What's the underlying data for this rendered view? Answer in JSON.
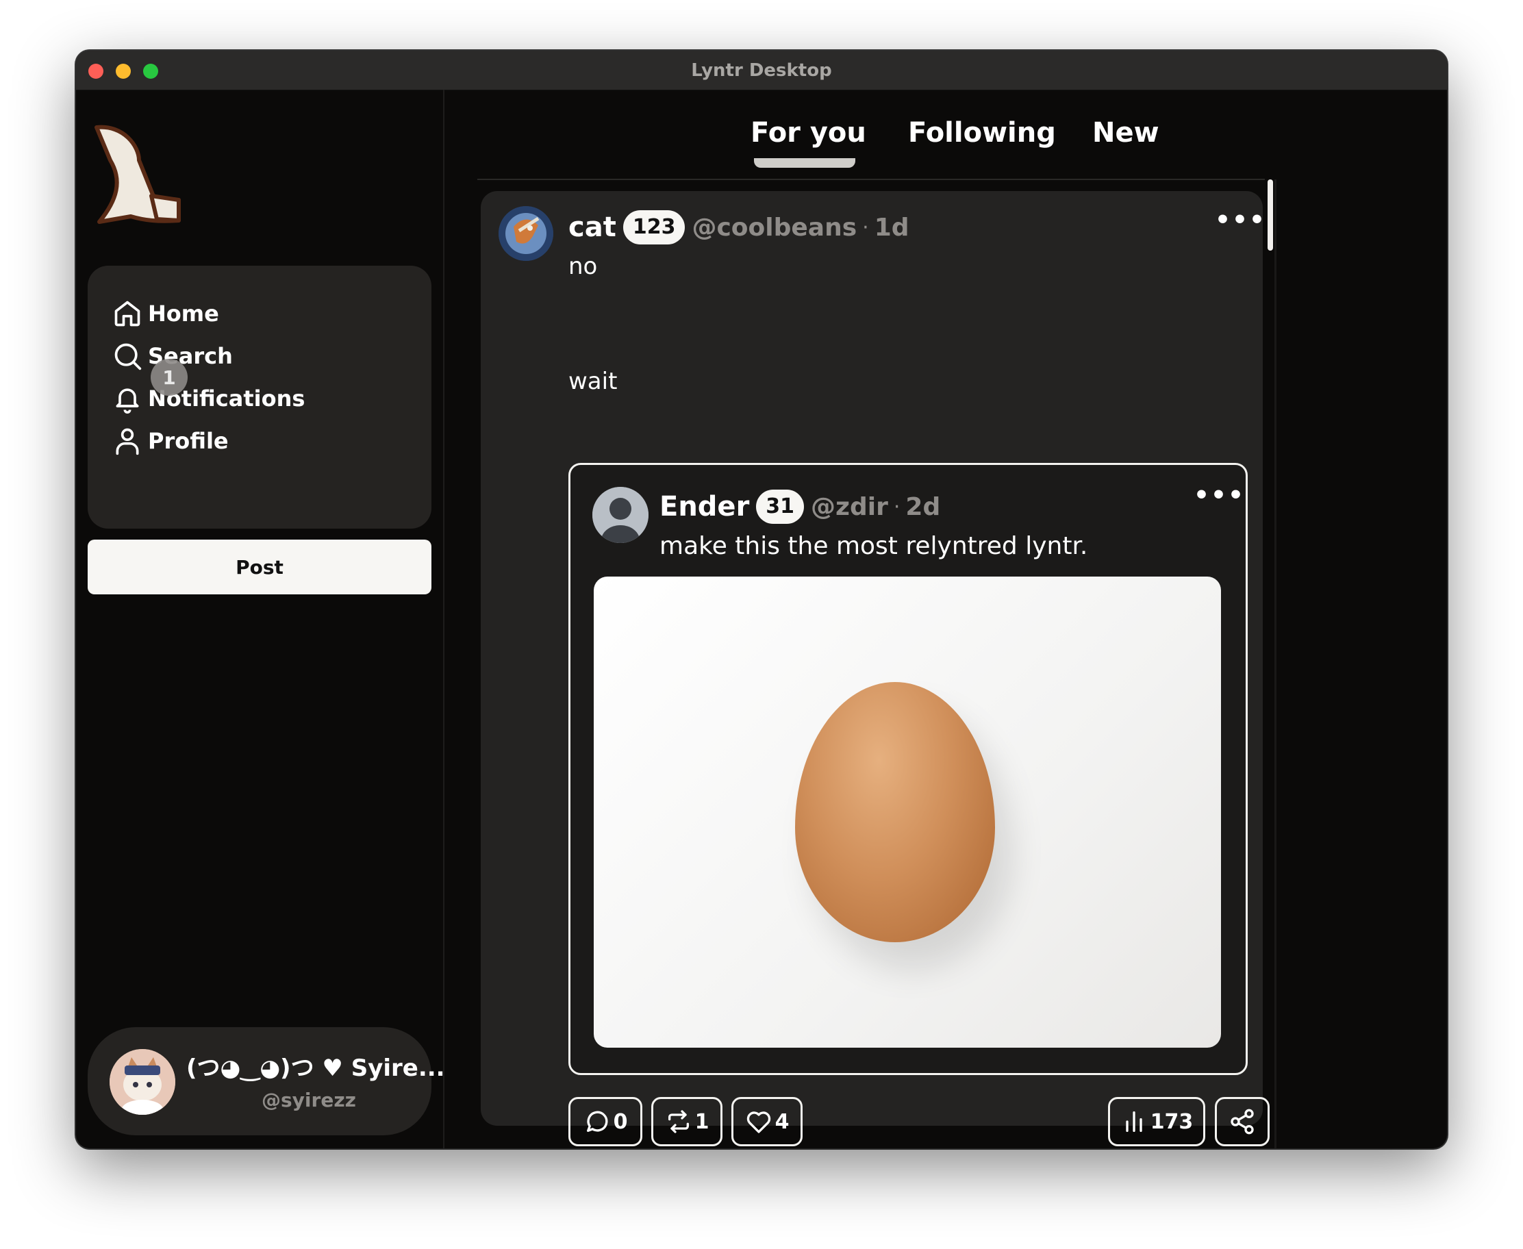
{
  "window": {
    "title": "Lyntr Desktop"
  },
  "sidebar": {
    "nav": [
      {
        "label": "Home",
        "icon": "home-icon"
      },
      {
        "label": "Search",
        "icon": "search-icon"
      },
      {
        "label": "Notifications",
        "icon": "bell-icon",
        "badge": "1"
      },
      {
        "label": "Profile",
        "icon": "user-icon"
      }
    ],
    "post_button": "Post",
    "account": {
      "name": "(つ◕‿◕)つ ♥ Syire...",
      "handle": "@syirezz"
    }
  },
  "tabs": [
    {
      "label": "For you",
      "active": true
    },
    {
      "label": "Following",
      "active": false
    },
    {
      "label": "New",
      "active": false
    }
  ],
  "post": {
    "author": "cat",
    "level": "123",
    "handle": "@coolbeans",
    "dot": "·",
    "time": "1d",
    "more": "•••",
    "text_line1": "no",
    "text_line2": "wait",
    "quote": {
      "author": "Ender",
      "level": "31",
      "handle": "@zdir",
      "dot": "·",
      "time": "2d",
      "more": "•••",
      "text": "make this the most relyntred lyntr."
    },
    "actions": {
      "comments": "0",
      "relyntrs": "1",
      "likes": "4",
      "views": "173"
    }
  },
  "colors": {
    "background": "#0b0a09",
    "panel": "#252321",
    "accent": "#f7f6f3",
    "muted": "#8f8c89"
  }
}
